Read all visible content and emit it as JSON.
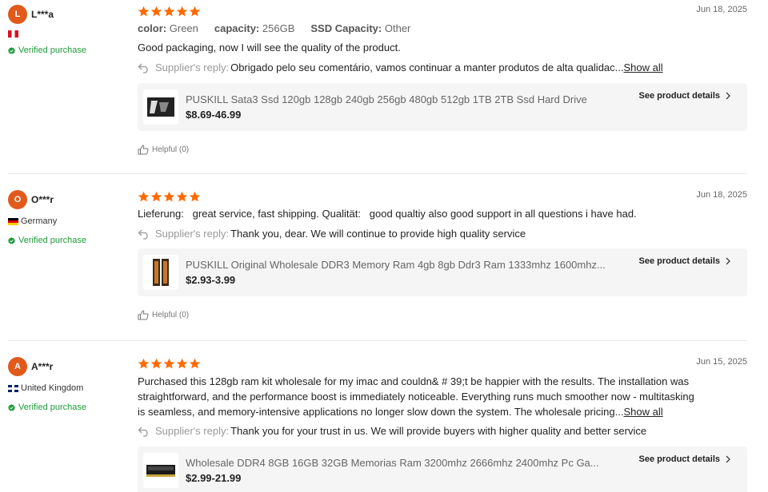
{
  "labels": {
    "verified": "Verified purchase",
    "supplier_reply": "Supplier's reply:",
    "show_all": "Show all",
    "see_details": "See product details",
    "helpful": "Helpful (0)"
  },
  "colors": {
    "avatar": "#e05a1c",
    "star": "#ff6a00",
    "verified": "#1f9a3a"
  },
  "reviews": [
    {
      "avatar_letter": "L",
      "username": "L***a",
      "country": "",
      "flag": "peru",
      "stars": 5,
      "date": "Jun 18, 2025",
      "attrs": [
        {
          "label": "color:",
          "value": "Green"
        },
        {
          "label": "capacity:",
          "value": "256GB"
        },
        {
          "label": "SSD Capacity:",
          "value": "Other"
        }
      ],
      "text": "Good packaging, now I will see the quality of the product.",
      "reply": "Obrigado pelo seu comentário, vamos continuar a manter produtos de alta qualidac...",
      "product": {
        "title": "PUSKILL Sata3 Ssd 120gb 128gb 240gb 256gb 480gb 512gb 1TB 2TB Ssd Hard Drive",
        "price": "$8.69-46.99",
        "icon": "ssd-thumbnail-icon"
      }
    },
    {
      "avatar_letter": "O",
      "username": "O***r",
      "country": "Germany",
      "flag": "de",
      "stars": 5,
      "date": "Jun 18, 2025",
      "text": "Lieferung:   great service, fast shipping. Qualität:   good qualtiy also good support in all questions i have had.",
      "reply": "Thank you, dear. We will continue to provide high quality service",
      "product": {
        "title": "PUSKILL Original Wholesale DDR3 Memory Ram 4gb 8gb Ddr3 Ram 1333mhz 1600mhz...",
        "price": "$2.93-3.99",
        "icon": "ram-thumbnail-icon"
      }
    },
    {
      "avatar_letter": "A",
      "username": "A***r",
      "country": "United Kingdom",
      "flag": "uk",
      "stars": 5,
      "date": "Jun 15, 2025",
      "text_lines": [
        "Purchased this 128gb ram kit wholesale for my imac and couldn& # 39;t be happier with the results. The installation was",
        "straightforward, and the performance boost is immediately noticeable. Everything runs much smoother now - multitasking",
        "is seamless, and memory-intensive applications no longer slow down the system. The wholesale pricing..."
      ],
      "reply": "Thank you for your trust in us. We will provide buyers with higher quality and better service",
      "product": {
        "title": "Wholesale DDR4 8GB 16GB 32GB Memorias Ram 3200mhz 2666mhz 2400mhz Pc Ga...",
        "price": "$2.99-21.99",
        "icon": "ram-stick-thumbnail-icon"
      }
    }
  ]
}
